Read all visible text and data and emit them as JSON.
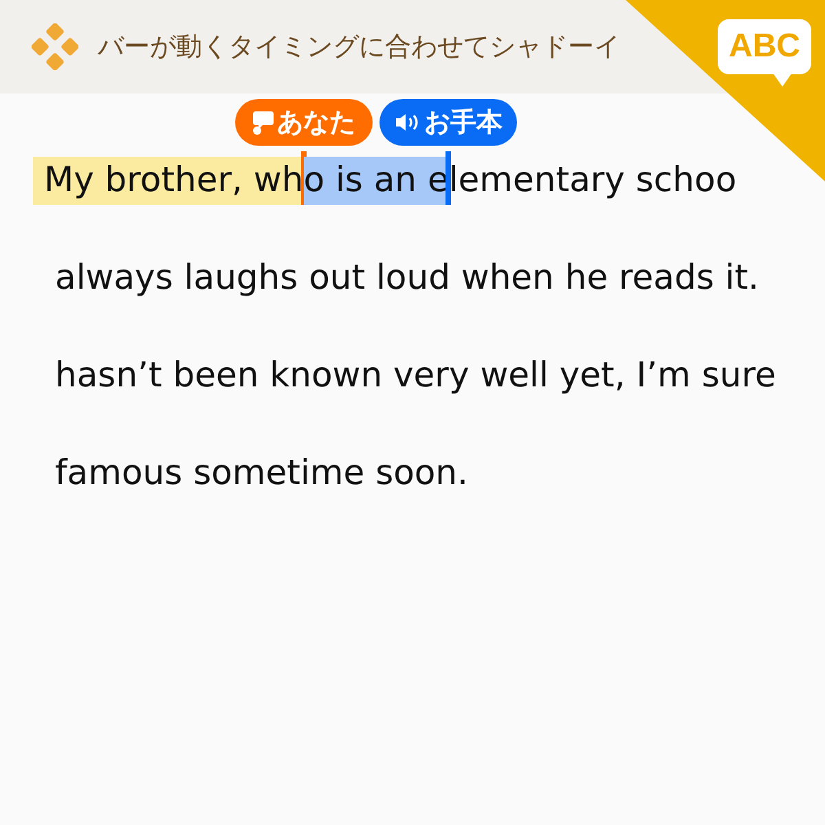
{
  "header": {
    "title": "バーが動くタイミングに合わせてシャドーイ",
    "badge": "ABC"
  },
  "lines": [
    {
      "segments": [
        {
          "text": "My brother, wh",
          "kind": "you",
          "marker": "あなた"
        },
        {
          "text": "o is an e",
          "kind": "model",
          "marker": "お手本"
        },
        {
          "text": "lementary schoo",
          "kind": "plain"
        }
      ]
    },
    {
      "segments": [
        {
          "text": "always laughs out loud when he reads it.",
          "kind": "plain"
        }
      ]
    },
    {
      "segments": [
        {
          "text": "hasn’t been known very well yet, I’m sure",
          "kind": "plain"
        }
      ]
    },
    {
      "segments": [
        {
          "text": "famous sometime soon.",
          "kind": "plain"
        }
      ]
    }
  ]
}
